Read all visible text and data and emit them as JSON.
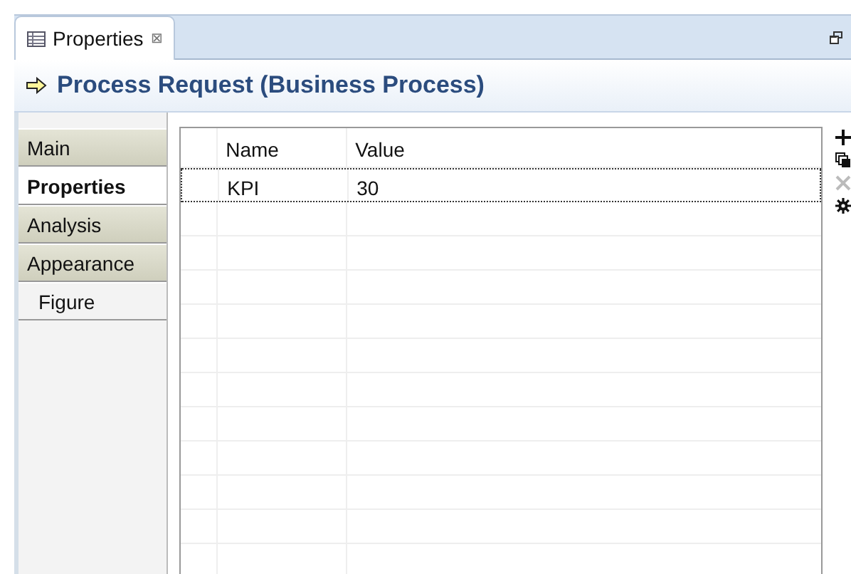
{
  "view_tab": {
    "title": "Properties",
    "close": "⊠"
  },
  "header": {
    "title": "Process Request (Business Process)"
  },
  "sidebar": {
    "items": [
      {
        "label": "Main",
        "selected": false
      },
      {
        "label": "Properties",
        "selected": true
      },
      {
        "label": "Analysis",
        "selected": false
      },
      {
        "label": "Appearance",
        "selected": false,
        "children": [
          {
            "label": "Figure",
            "selected": false
          }
        ]
      }
    ]
  },
  "table": {
    "columns": [
      "Name",
      "Value"
    ],
    "rows": [
      {
        "name": "KPI",
        "value": "30",
        "selected": true
      }
    ]
  },
  "toolbar": [
    {
      "kind": "add",
      "disabled": false
    },
    {
      "kind": "copy",
      "disabled": false
    },
    {
      "kind": "delete",
      "disabled": true
    },
    {
      "kind": "settings",
      "disabled": false
    }
  ]
}
